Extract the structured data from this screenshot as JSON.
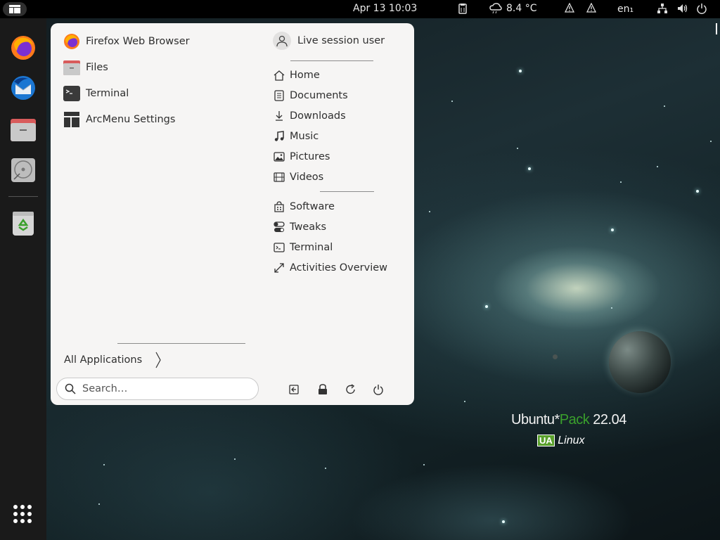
{
  "topbar": {
    "clock": "Apr 13  10:03",
    "weather_temp": "8.4 °C",
    "keyboard_layout": "en₁"
  },
  "menu": {
    "favorites": [
      {
        "label": "Firefox Web Browser",
        "icon": "firefox-icon"
      },
      {
        "label": "Files",
        "icon": "files-icon"
      },
      {
        "label": "Terminal",
        "icon": "terminal-icon"
      },
      {
        "label": "ArcMenu Settings",
        "icon": "arcmenu-settings-icon"
      }
    ],
    "user": {
      "name": "Live session user",
      "icon": "avatar-icon"
    },
    "places": [
      {
        "label": "Home",
        "icon": "home-icon"
      },
      {
        "label": "Documents",
        "icon": "document-icon"
      },
      {
        "label": "Downloads",
        "icon": "download-icon"
      },
      {
        "label": "Music",
        "icon": "music-icon"
      },
      {
        "label": "Pictures",
        "icon": "picture-icon"
      },
      {
        "label": "Videos",
        "icon": "video-icon"
      }
    ],
    "system": [
      {
        "label": "Software",
        "icon": "software-icon"
      },
      {
        "label": "Tweaks",
        "icon": "tweaks-icon"
      },
      {
        "label": "Terminal",
        "icon": "terminal-icon"
      },
      {
        "label": "Activities Overview",
        "icon": "expand-icon"
      }
    ],
    "all_applications_label": "All Applications",
    "search_placeholder": "Search…"
  },
  "desktop": {
    "brand_prefix": "Ubuntu*",
    "brand_accent": "Pack",
    "brand_version": " 22.04",
    "logo_badge": "UA",
    "logo_text": "Linux"
  },
  "colors": {
    "accent_green": "#3aa02c",
    "menu_bg": "#f6f5f4",
    "topbar_bg": "#000000",
    "dock_bg": "#1a1a1a"
  }
}
